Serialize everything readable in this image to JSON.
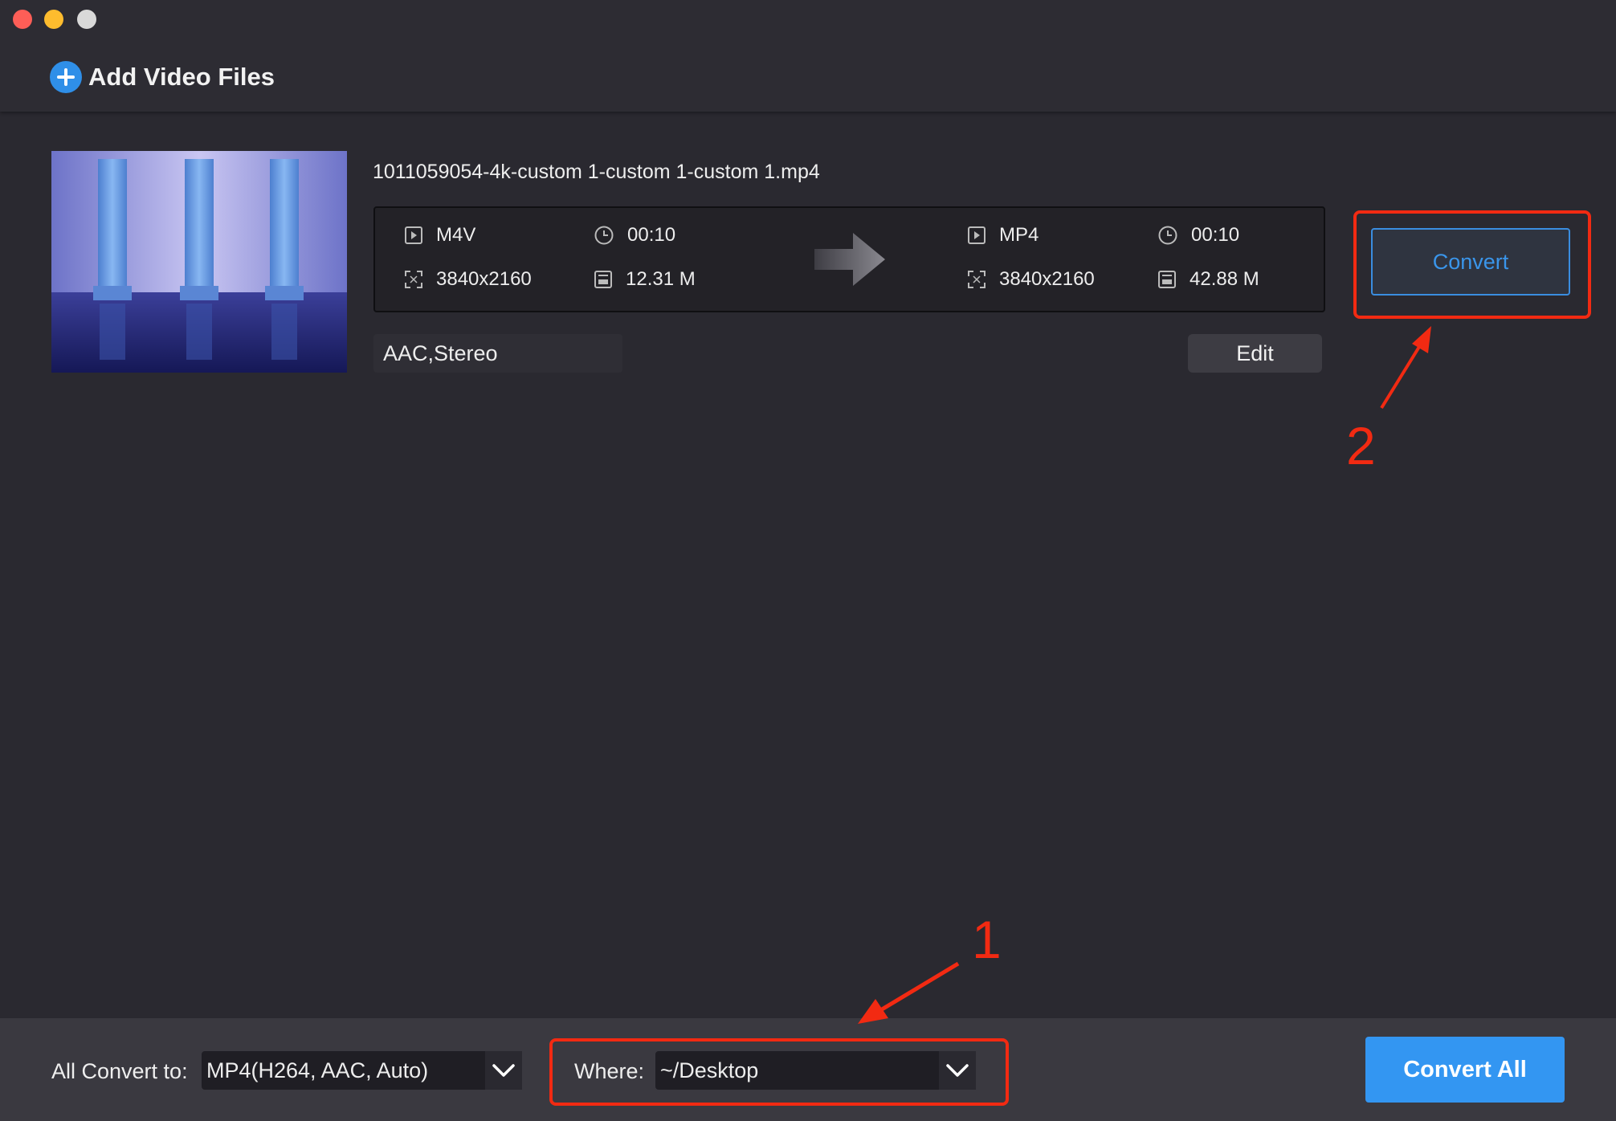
{
  "toolbar": {
    "add_label": "Add Video Files"
  },
  "file": {
    "name": "1011059054-4k-custom 1-custom 1-custom 1.mp4",
    "source": {
      "format": "M4V",
      "duration": "00:10",
      "resolution": "3840x2160",
      "size": "12.31 M"
    },
    "target": {
      "format": "MP4",
      "duration": "00:10",
      "resolution": "3840x2160",
      "size": "42.88 M"
    },
    "audio": "AAC,Stereo",
    "edit_label": "Edit",
    "convert_label": "Convert"
  },
  "bottom": {
    "convert_to_label": "All Convert to:",
    "convert_to_value": "MP4(H264, AAC, Auto)",
    "where_label": "Where:",
    "where_value": "~/Desktop",
    "convert_all_label": "Convert All"
  },
  "annotations": {
    "step1": "1",
    "step2": "2"
  },
  "colors": {
    "accent": "#3396f2",
    "annotation": "#f22a12",
    "background": "#2a2930"
  }
}
